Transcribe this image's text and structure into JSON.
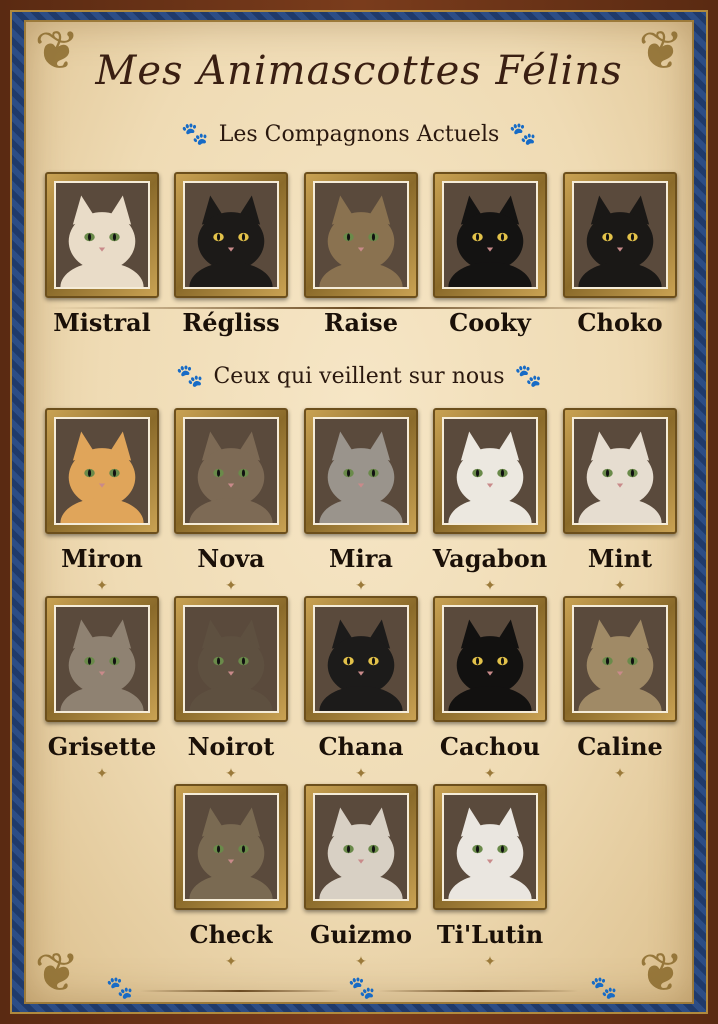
{
  "title": "Mes Animascottes Félins",
  "sections": {
    "current": "Les Compagnons Actuels",
    "memorial": "Ceux qui veillent sur nous"
  },
  "current_cats": [
    {
      "name": "Mistral",
      "color": "#e9dcc8"
    },
    {
      "name": "Régliss",
      "color": "#1c1a18"
    },
    {
      "name": "Raise",
      "color": "#8a7250"
    },
    {
      "name": "Cooky",
      "color": "#141312"
    },
    {
      "name": "Choko",
      "color": "#1a1816"
    }
  ],
  "memorial_cats": [
    {
      "name": "Miron",
      "color": "#e0a55a"
    },
    {
      "name": "Nova",
      "color": "#7d6a55"
    },
    {
      "name": "Mira",
      "color": "#9a948c"
    },
    {
      "name": "Vagabon",
      "color": "#ece8e0"
    },
    {
      "name": "Mint",
      "color": "#e6ddd0"
    },
    {
      "name": "Grisette",
      "color": "#8f8272"
    },
    {
      "name": "Noirot",
      "color": "#5e5040"
    },
    {
      "name": "Chana",
      "color": "#1c1b1a"
    },
    {
      "name": "Cachou",
      "color": "#121110"
    },
    {
      "name": "Caline",
      "color": "#a08a66"
    },
    {
      "name": "Check",
      "color": "#7a6a52"
    },
    {
      "name": "Guizmo",
      "color": "#d8d0c4"
    },
    {
      "name": "Ti'Lutin",
      "color": "#eae6e0"
    }
  ],
  "icons": {
    "paw": "paw-icon",
    "star": "star-ornament-icon"
  }
}
